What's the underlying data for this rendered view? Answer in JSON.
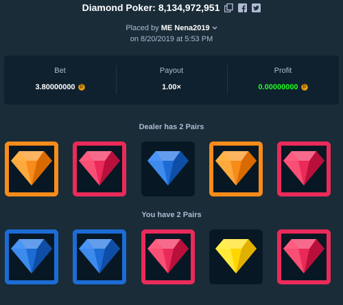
{
  "header": {
    "title": "Diamond Poker: 8,134,972,951",
    "placed_by_prefix": "Placed by",
    "user": "ME Nena2019",
    "date_line": "on 8/20/2019 at 5:53 PM"
  },
  "stats": {
    "bet_label": "Bet",
    "bet_value": "3.80000000",
    "payout_label": "Payout",
    "payout_value": "1.00×",
    "profit_label": "Profit",
    "profit_value": "0.00000000"
  },
  "dealer": {
    "label": "Dealer has 2 Pairs",
    "cards": [
      {
        "gem": "orange",
        "highlight": "orange"
      },
      {
        "gem": "red",
        "highlight": "red"
      },
      {
        "gem": "blue",
        "highlight": "none"
      },
      {
        "gem": "orange",
        "highlight": "orange"
      },
      {
        "gem": "red",
        "highlight": "red"
      }
    ]
  },
  "player": {
    "label": "You have 2 Pairs",
    "cards": [
      {
        "gem": "blue",
        "highlight": "blue"
      },
      {
        "gem": "blue",
        "highlight": "blue"
      },
      {
        "gem": "red",
        "highlight": "red"
      },
      {
        "gem": "yellow",
        "highlight": "none"
      },
      {
        "gem": "red",
        "highlight": "red"
      }
    ]
  },
  "colors": {
    "background": "#1a2c38",
    "panel": "#0f212e",
    "profit": "#1fff20",
    "orange": "#f78c1b",
    "red": "#ea2b5a",
    "blue": "#1d6cd5",
    "yellow": "#ffe500"
  },
  "icons": [
    "copy-icon",
    "facebook-icon",
    "twitter-icon",
    "chevron-down-icon",
    "coin-icon"
  ]
}
